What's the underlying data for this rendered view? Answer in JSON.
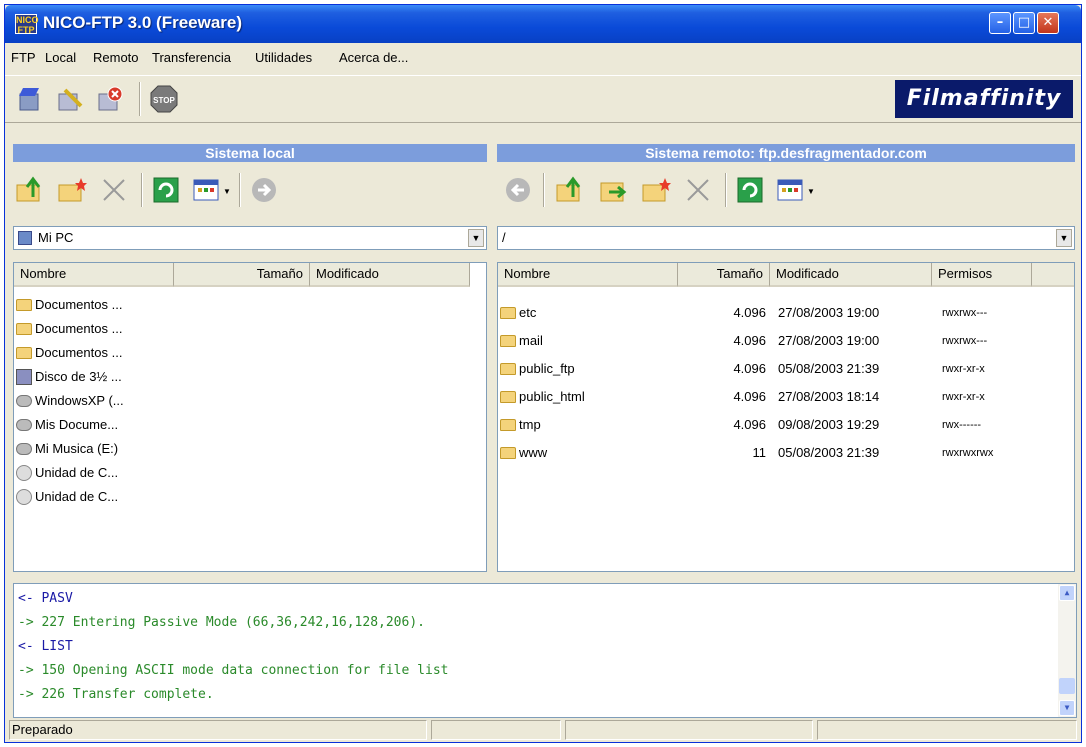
{
  "window": {
    "title": "NICO-FTP 3.0  (Freeware)",
    "icon_text": "NICO FTP",
    "minimize": "–",
    "maximize": "□",
    "close": "✕"
  },
  "menu": [
    "FTP",
    "Local",
    "Remoto",
    "Transferencia",
    "Utilidades",
    "Acerca de..."
  ],
  "toolbar": {
    "stop_label": "STOP",
    "logo_text": "Filmaffinity"
  },
  "local": {
    "header": "Sistema local",
    "path": "Mi PC",
    "columns": [
      "Nombre",
      "Tamaño",
      "Modificado"
    ],
    "items": [
      {
        "name": "Documentos ...",
        "icon": "folder"
      },
      {
        "name": "Documentos ...",
        "icon": "folder"
      },
      {
        "name": "Documentos ...",
        "icon": "folder"
      },
      {
        "name": "Disco de 3½ ...",
        "icon": "floppy"
      },
      {
        "name": "WindowsXP (...",
        "icon": "drive"
      },
      {
        "name": "Mis Docume...",
        "icon": "drive"
      },
      {
        "name": "Mi Musica (E:)",
        "icon": "drive"
      },
      {
        "name": "Unidad de C...",
        "icon": "cd"
      },
      {
        "name": "Unidad de C...",
        "icon": "cd"
      }
    ]
  },
  "remote": {
    "header": "Sistema remoto: ftp.desfragmentador.com",
    "path": "/",
    "columns": [
      "Nombre",
      "Tamaño",
      "Modificado",
      "Permisos"
    ],
    "items": [
      {
        "name": "etc",
        "size": "4.096",
        "modified": "27/08/2003 19:00",
        "perms": "rwxrwx---"
      },
      {
        "name": "mail",
        "size": "4.096",
        "modified": "27/08/2003 19:00",
        "perms": "rwxrwx---"
      },
      {
        "name": "public_ftp",
        "size": "4.096",
        "modified": "05/08/2003 21:39",
        "perms": "rwxr-xr-x"
      },
      {
        "name": "public_html",
        "size": "4.096",
        "modified": "27/08/2003 18:14",
        "perms": "rwxr-xr-x"
      },
      {
        "name": "tmp",
        "size": "4.096",
        "modified": "09/08/2003 19:29",
        "perms": "rwx------"
      },
      {
        "name": "www",
        "size": "11",
        "modified": "05/08/2003 21:39",
        "perms": "rwxrwxrwx"
      }
    ]
  },
  "log": [
    {
      "text": "<- PASV",
      "color": "#1a1aa6"
    },
    {
      "text": "-> 227 Entering Passive Mode (66,36,242,16,128,206).",
      "color": "#2a8a2a"
    },
    {
      "text": "<- LIST",
      "color": "#1a1aa6"
    },
    {
      "text": "-> 150 Opening ASCII mode data connection for file list",
      "color": "#2a8a2a"
    },
    {
      "text": "-> 226 Transfer complete.",
      "color": "#2a8a2a"
    }
  ],
  "status": {
    "text": "Preparado"
  }
}
